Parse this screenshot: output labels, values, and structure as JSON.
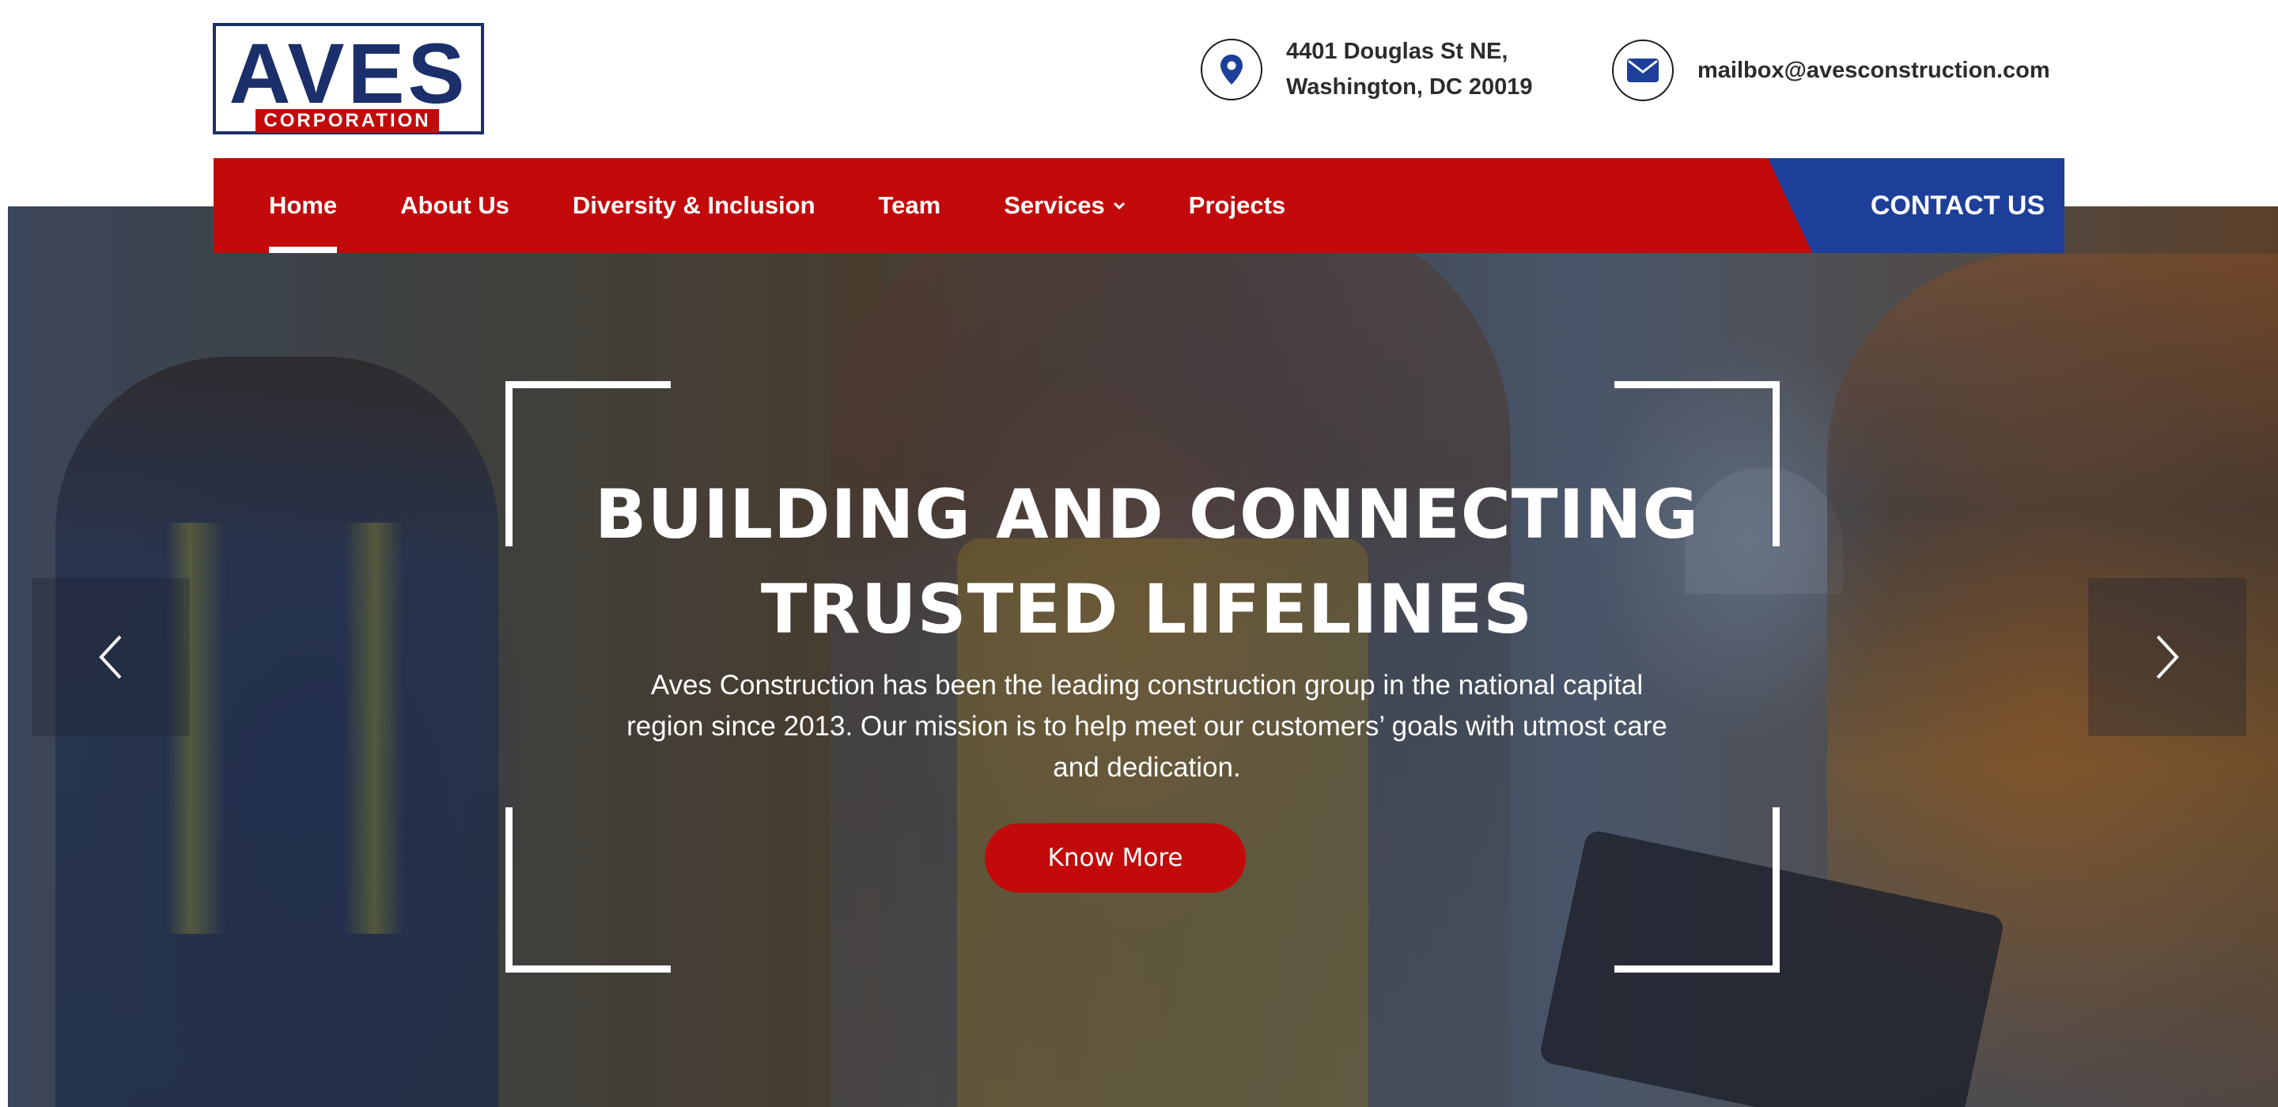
{
  "brand": {
    "logo_word": "AVES",
    "logo_sub": "CORPORATION",
    "navy": "#1b2f6b",
    "red": "#c20a0a",
    "blue": "#1d3f9a"
  },
  "header": {
    "address_line1": "4401 Douglas St NE,",
    "address_line2": "Washington, DC 20019",
    "address_icon": "map-pin-icon",
    "email": "mailbox@avesconstruction.com",
    "email_icon": "envelope-icon"
  },
  "nav": {
    "items": [
      {
        "label": "Home",
        "active": true
      },
      {
        "label": "About Us"
      },
      {
        "label": "Diversity & Inclusion"
      },
      {
        "label": "Team"
      },
      {
        "label": "Services",
        "has_dropdown": true
      },
      {
        "label": "Projects"
      }
    ],
    "contact_label": "CONTACT US"
  },
  "hero": {
    "title_line1": "BUILDING AND CONNECTING",
    "title_line2": "TRUSTED LIFELINES",
    "description": "Aves Construction has been the leading construction group in the national capital region since 2013. Our mission is to help meet our customers’ goals with utmost care and dedication.",
    "cta_label": "Know More",
    "prev_icon": "chevron-left-icon",
    "next_icon": "chevron-right-icon"
  }
}
